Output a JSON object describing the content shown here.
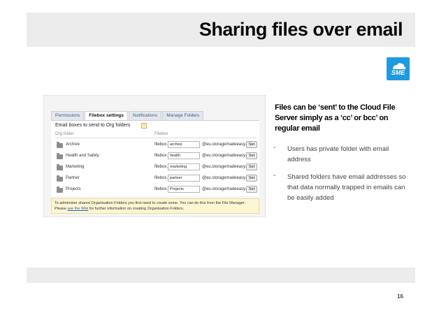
{
  "slide": {
    "title": "Sharing files over email",
    "logo_text": "SME",
    "page_number": "16"
  },
  "screenshot": {
    "tabs": [
      "Permissions",
      "Filebox settings",
      "Notifications",
      "Manage Folders"
    ],
    "active_tab": "Filebox settings",
    "heading": "Email boxes to send to Org folders",
    "help_icon": "i",
    "col_org_folder": "Org folder",
    "col_filebox": "Filebox",
    "rows": [
      {
        "name": "Archive",
        "prefix": "filebox.",
        "value": "archive",
        "domain": "@eu.storagemadeeasy.com",
        "button": "Set"
      },
      {
        "name": "Health and Safety",
        "prefix": "filebox.",
        "value": "health",
        "domain": "@eu.storagemadeeasy.com",
        "button": "Set"
      },
      {
        "name": "Marketing",
        "prefix": "filebox.",
        "value": "marketing",
        "domain": "@eu.storagemadeeasy.com",
        "button": "Set"
      },
      {
        "name": "Partner",
        "prefix": "filebox.",
        "value": "partner",
        "domain": "@eu.storagemadeeasy.com",
        "button": "Set"
      },
      {
        "name": "Projects",
        "prefix": "filebox.",
        "value": "Projects",
        "domain": "@eu.storagemadeeasy.com",
        "button": "Set"
      }
    ],
    "note_line1": "To administer shared Organisation Folders you first need to create some. You can do this from the File Manager.",
    "note_pre": "Please ",
    "note_link": "see the Wiki",
    "note_post": " for further information on creating Organisation Folders."
  },
  "content": {
    "bold_text": "Files can be ‘sent’ to the Cloud File Server simply as a ‘cc’ or bcc’ on regular email",
    "bullets": [
      "Users has private folder with email address",
      "Shared folders have email addresses so that data normally trapped in emails can be easily added"
    ],
    "bullet_marker": "-"
  },
  "colors": {
    "logo_blue": "#1e9be0",
    "band_gray": "#ececec"
  }
}
